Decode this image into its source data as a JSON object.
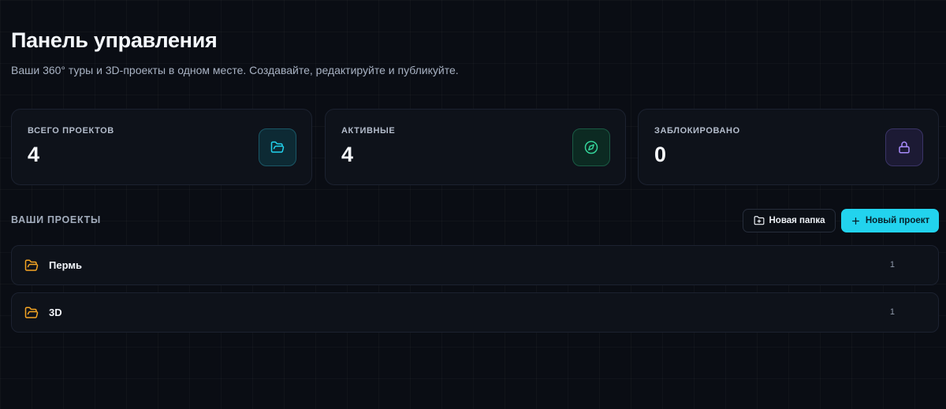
{
  "header": {
    "title": "Панель управления",
    "subtitle": "Ваши 360° туры и 3D-проекты в одном месте. Создавайте, редактируйте и публикуйте."
  },
  "stats": [
    {
      "label": "ВСЕГО ПРОЕКТОВ",
      "value": "4",
      "icon": "folder-open-icon",
      "color": "#22d3ee"
    },
    {
      "label": "АКТИВНЫЕ",
      "value": "4",
      "icon": "compass-icon",
      "color": "#34d399"
    },
    {
      "label": "ЗАБЛОКИРОВАНО",
      "value": "0",
      "icon": "lock-icon",
      "color": "#a78bfa"
    }
  ],
  "projects": {
    "section_title": "ВАШИ ПРОЕКТЫ",
    "new_folder_label": "Новая папка",
    "new_project_label": "Новый проект",
    "folders": [
      {
        "name": "Пермь",
        "count": "1",
        "icon": "folder-icon"
      },
      {
        "name": "3D",
        "count": "1",
        "icon": "folder-icon"
      }
    ]
  },
  "colors": {
    "accent": "#22d3ee",
    "folder": "#f5a524",
    "background": "#0a0d14"
  }
}
